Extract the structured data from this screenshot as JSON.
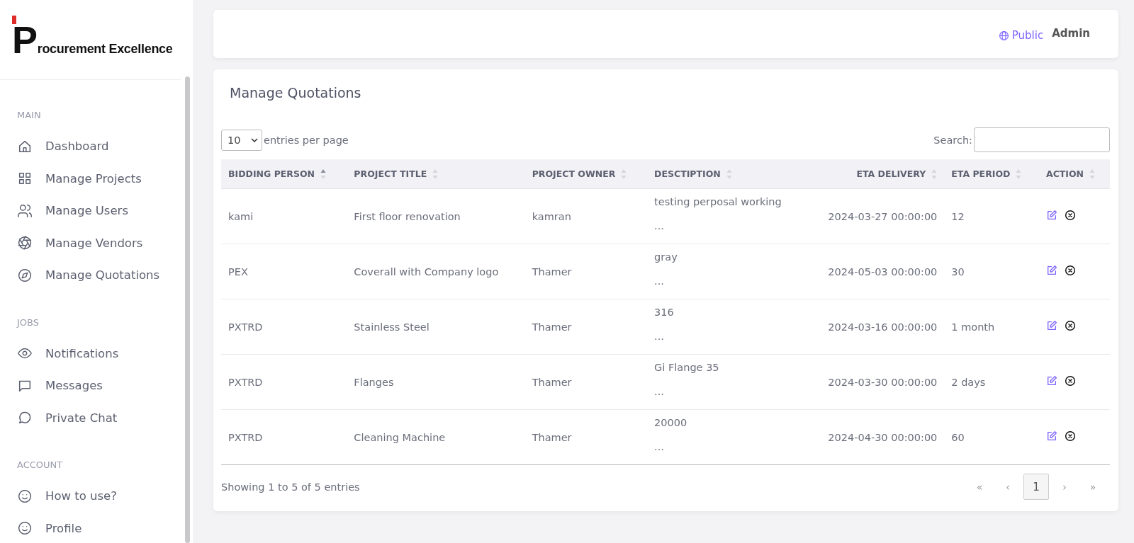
{
  "logo": {
    "initial": "P",
    "text": "rocurement Excellence"
  },
  "sidebar": {
    "sections": [
      {
        "title": "MAIN",
        "items": [
          {
            "label": "Dashboard",
            "selected": false
          },
          {
            "label": "Manage Projects",
            "selected": false
          },
          {
            "label": "Manage Users",
            "selected": false
          },
          {
            "label": "Manage Vendors",
            "selected": false
          },
          {
            "label": "Manage Quotations",
            "selected": false
          }
        ]
      },
      {
        "title": "JOBS",
        "items": [
          {
            "label": "Notifications",
            "selected": false
          },
          {
            "label": "Messages",
            "selected": false
          },
          {
            "label": "Private Chat",
            "selected": false
          }
        ]
      },
      {
        "title": "ACCOUNT",
        "items": [
          {
            "label": "How to use?",
            "selected": false
          },
          {
            "label": "Profile",
            "selected": false
          }
        ]
      }
    ]
  },
  "header": {
    "public_link": "Public",
    "user": "Admin"
  },
  "card_title": "Manage Quotations",
  "page_size": {
    "value": "10",
    "label": "entries per page"
  },
  "search": {
    "label": "Search:"
  },
  "table": {
    "columns": [
      {
        "label": "BIDDING PERSON",
        "sorted_ascending": true
      },
      {
        "label": "PROJECT TITLE",
        "sorted_ascending": false
      },
      {
        "label": "PROJECT OWNER",
        "sorted_ascending": false
      },
      {
        "label": "DESCTIPTION",
        "sorted_ascending": false
      },
      {
        "label": "ETA DELIVERY",
        "sorted_ascending": false
      },
      {
        "label": "ETA PERIOD",
        "sorted_ascending": false
      },
      {
        "label": "ACTION",
        "sorted_ascending": false
      }
    ],
    "rows": [
      {
        "bidding_person": "kami",
        "project_title": "First floor renovation",
        "project_owner": "kamran",
        "description": "testing perposal working",
        "description_more": "...",
        "eta_delivery": "2024-03-27 00:00:00",
        "eta_period": "12"
      },
      {
        "bidding_person": "PEX",
        "project_title": "Coverall with Company logo",
        "project_owner": "Thamer",
        "description": "gray",
        "description_more": "...",
        "eta_delivery": "2024-05-03 00:00:00",
        "eta_period": "30"
      },
      {
        "bidding_person": "PXTRD",
        "project_title": "Stainless Steel",
        "project_owner": "Thamer",
        "description": "316",
        "description_more": "...",
        "eta_delivery": "2024-03-16 00:00:00",
        "eta_period": "1 month"
      },
      {
        "bidding_person": "PXTRD",
        "project_title": "Flanges",
        "project_owner": "Thamer",
        "description": "Gi Flange 35",
        "description_more": "...",
        "eta_delivery": "2024-03-30 00:00:00",
        "eta_period": "2 days"
      },
      {
        "bidding_person": "PXTRD",
        "project_title": "Cleaning Machine",
        "project_owner": "Thamer",
        "description": "20000",
        "description_more": "...",
        "eta_delivery": "2024-04-30 00:00:00",
        "eta_period": "60"
      }
    ]
  },
  "footer": {
    "info": "Showing 1 to 5 of 5 entries",
    "pages": [
      {
        "label": "«",
        "selected": false
      },
      {
        "label": "‹",
        "selected": false
      },
      {
        "label": "1",
        "selected": true
      },
      {
        "label": "›",
        "selected": false
      },
      {
        "label": "»",
        "selected": false
      }
    ]
  }
}
